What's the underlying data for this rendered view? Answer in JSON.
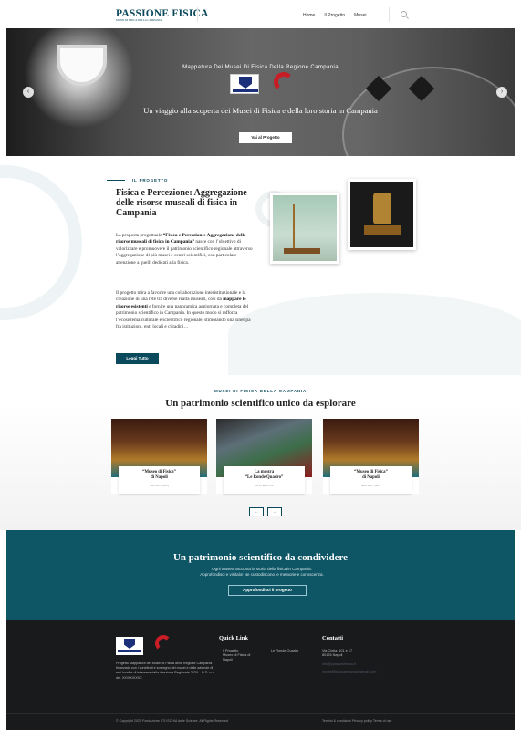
{
  "header": {
    "logo": "PASSIONE FISICA",
    "logo_sub": "MUSEI DI FISICA DELLA CAMPANIA",
    "nav": [
      "Home",
      "Il Progetto",
      "Musei"
    ]
  },
  "hero": {
    "kicker": "Mappatura Dei Musei Di Fisica Della Regione Campania",
    "title": "Un viaggio alla scoperta dei Musei di Fisica e della loro storia in Campania",
    "button": "Vai al Progetto",
    "prev": "‹",
    "next": "›"
  },
  "project": {
    "kicker": "IL PROGETTO",
    "title": "Fisica e Percezione: Aggregazione delle risorse museali di fisica in Campania",
    "p1_lead": "La proposta progettuale ",
    "p1_bold": "“Fisica e Percezione: Aggregazione delle risorse museali di fisica in Campania”",
    "p1_rest": " nasce con l’obiettivo di valorizzare e promuovere il patrimonio scientifico regionale attraverso l’aggregazione di più musei e centri scientifici, con particolare attenzione a quelli dedicati alla fisica.",
    "p2_lead": "Il progetto mira a favorire una collaborazione interistituzionale e la creazione di una rete tra diverse realtà museali, così da ",
    "p2_bold": "mappare le risorse esistenti",
    "p2_rest": " e fornire una panoramica aggiornata e completa del patrimonio scientifico in Campania. In questo modo si rafforza l’ecosistema culturale e scientifico regionale, stimolando una sinergia fra istituzioni, enti locali e cittadini…",
    "button": "Leggi Tutto"
  },
  "musei": {
    "kicker": "MUSEI DI FISICA DELLA CAMPANIA",
    "title": "Un patrimonio scientifico unico da esplorare",
    "cards": [
      {
        "title": "“Museo di Fisica”",
        "title2": "di Napoli",
        "sub": "NAPOLI (NA)"
      },
      {
        "title": "La mostra",
        "title2": "“Le Ronde Quadro”",
        "sub": "CASTELVISC"
      },
      {
        "title": "“Museo di Fisica”",
        "title2": "di Napoli",
        "sub": "NAPOLI (NA)"
      }
    ],
    "prev": "←",
    "next": "→"
  },
  "cta": {
    "title": "Un patrimonio scientifico da condividere",
    "text1": "Ogni museo racconta la storia della fisica in Campania.",
    "text2": "Approfondisci e visitalo! Ne custodiscono le memorie e conoscenza.",
    "button": "Approfondisci il progetto"
  },
  "footer": {
    "desc": "Progetto Mappatura dei Musei di Fisica della Regione Campania finanziato con i contributi e sostegno dei musei e delle aziende di enti locali e di interesse dalla direzione Regionale 2020 – D.D. n.o del. XX/XX/XXXX",
    "quick_title": "Quick Link",
    "quick_links_col1": [
      "Il Progetto",
      "Museo di Fisica di",
      "Napoli"
    ],
    "quick_links_col2": [
      "Le Ronde Quadro"
    ],
    "contact_title": "Contatti",
    "contacts": [
      "Via Cintia, 101 e 17",
      "80126 Napoli"
    ],
    "contacts_muted": [
      "info@passionefisica.it",
      "museidifisicacampania@gmail.com"
    ],
    "copyright": "© Copyright 2025 Fondazione ITS ISCHIA delle Scienze, All Rights Reserved",
    "legal": "Termini & condizioni  Privacy policy  Terms of use"
  }
}
